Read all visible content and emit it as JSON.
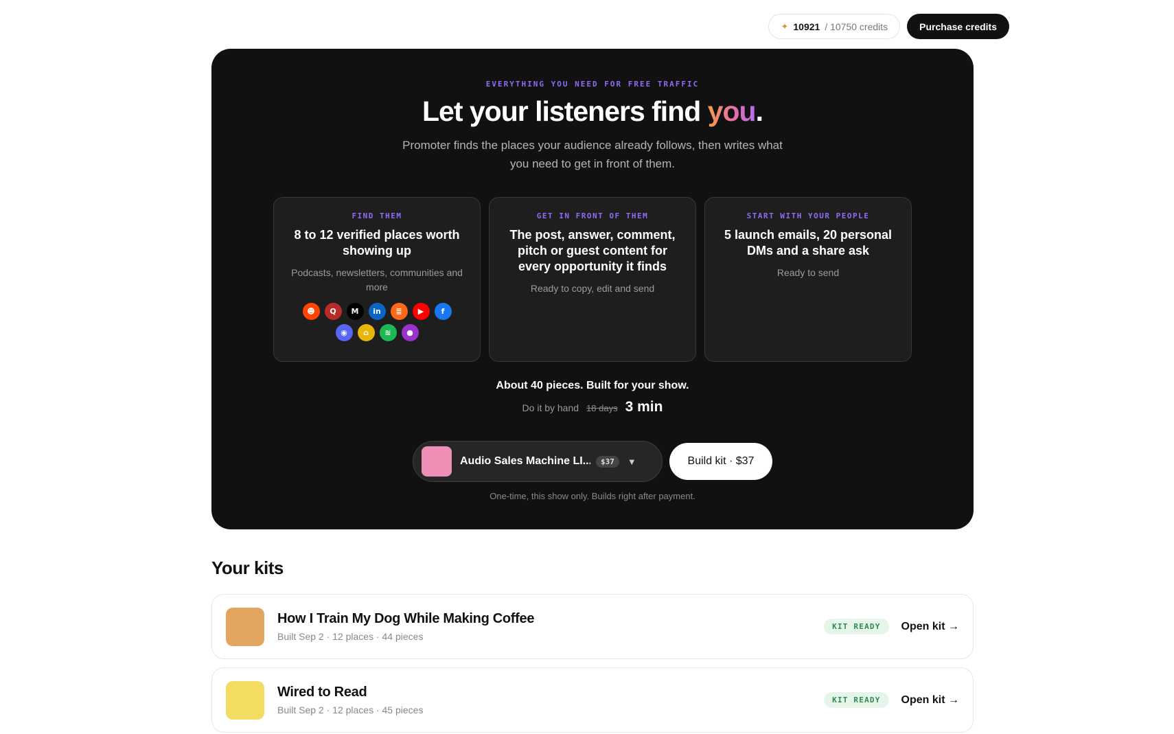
{
  "topbar": {
    "credits_current": "10921",
    "credits_max": "/ 10750 credits",
    "purchase_label": "Purchase credits"
  },
  "hero": {
    "eyebrow": "EVERYTHING YOU NEED FOR FREE TRAFFIC",
    "title_main": "Let your listeners find ",
    "title_accent": "you",
    "title_end": ".",
    "subtitle": "Promoter finds the places your audience already follows, then writes what you need to get in front of them.",
    "cards": [
      {
        "eyebrow": "FIND THEM",
        "title": "8 to 12 verified places worth showing up",
        "desc": "Podcasts, newsletters, communities and more"
      },
      {
        "eyebrow": "GET IN FRONT OF THEM",
        "title": "The post, answer, comment, pitch or guest content for every opportunity it finds",
        "desc": "Ready to copy, edit and send"
      },
      {
        "eyebrow": "START WITH YOUR PEOPLE",
        "title": "5 launch emails, 20 personal DMs and a share ask",
        "desc": "Ready to send"
      }
    ],
    "platforms": [
      {
        "name": "reddit-icon",
        "glyph": "☻",
        "color": "#ff4500"
      },
      {
        "name": "quora-icon",
        "glyph": "Q",
        "color": "#b92b27"
      },
      {
        "name": "medium-icon",
        "glyph": "M",
        "color": "#000000"
      },
      {
        "name": "linkedin-icon",
        "glyph": "in",
        "color": "#0a66c2"
      },
      {
        "name": "substack-icon",
        "glyph": "≣",
        "color": "#ff6719"
      },
      {
        "name": "youtube-icon",
        "glyph": "▶",
        "color": "#ff0000"
      },
      {
        "name": "facebook-icon",
        "glyph": "f",
        "color": "#1877f2"
      },
      {
        "name": "discord-icon",
        "glyph": "◉",
        "color": "#5865f2"
      },
      {
        "name": "producthunt-icon",
        "glyph": "⌂",
        "color": "#e8b50a"
      },
      {
        "name": "spotify-icon",
        "glyph": "≋",
        "color": "#1db954"
      },
      {
        "name": "apple-podcasts-icon",
        "glyph": "●",
        "color": "#9933cc"
      }
    ],
    "pieces": "About 40 pieces. Built for your show.",
    "compare_label": "Do it by hand",
    "compare_old": "18 days",
    "compare_new": "3 min",
    "picker_name": "Audio Sales Machine LI...",
    "picker_price": "$37",
    "picker_thumb_color": "#f08fb5",
    "build_label": "Build kit · $37",
    "fine_print": "One-time, this show only. Builds right after payment."
  },
  "kits": {
    "title": "Your kits",
    "items": [
      {
        "name": "How I Train My Dog While Making Coffee",
        "meta": "Built Sep 2 · 12 places · 44 pieces",
        "status": "KIT READY",
        "open_label": "Open kit →",
        "thumb_color": "#e3a45f"
      },
      {
        "name": "Wired to Read",
        "meta": "Built Sep 2 · 12 places · 45 pieces",
        "status": "KIT READY",
        "open_label": "Open kit →",
        "thumb_color": "#f4dc63"
      }
    ]
  }
}
